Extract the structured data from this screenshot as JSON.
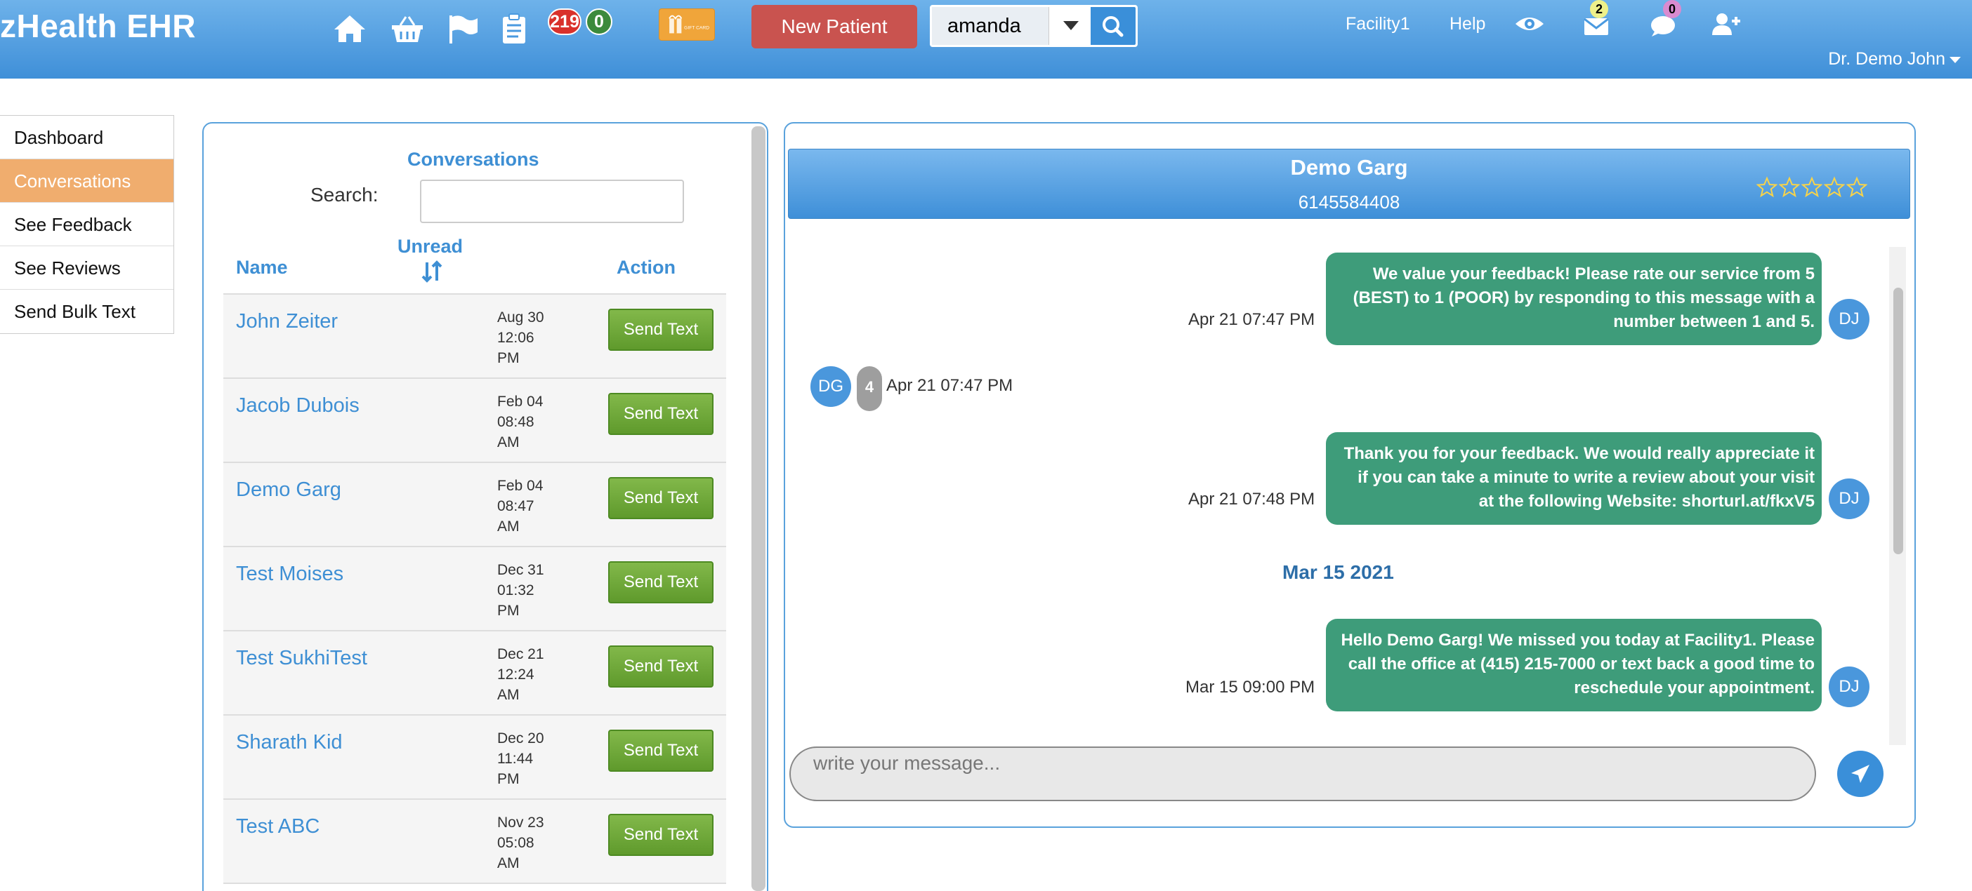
{
  "app": {
    "title": "zHealth EHR"
  },
  "topbar": {
    "icons": [
      "home-icon",
      "basket-icon",
      "flag-icon",
      "clipboard-icon"
    ],
    "badge_alerts": "219",
    "badge_zero": "0",
    "gift_card_label": "GIFT CARD",
    "new_patient_label": "New Patient",
    "search_value": "amanda",
    "facility": "Facility1",
    "help": "Help",
    "mail_count": "2",
    "chat_count": "0",
    "user": "Dr. Demo John",
    "colors": {
      "bar": "#4a9ae0",
      "new_patient": "#c9534f",
      "badge_red": "#d9312b",
      "badge_green": "#3c8a3c"
    }
  },
  "sidebar": {
    "items": [
      {
        "label": "Dashboard",
        "active": false
      },
      {
        "label": "Conversations",
        "active": true
      },
      {
        "label": "See Feedback",
        "active": false
      },
      {
        "label": "See Reviews",
        "active": false
      },
      {
        "label": "Send Bulk Text",
        "active": false
      }
    ]
  },
  "conversations": {
    "title": "Conversations",
    "search_label": "Search:",
    "search_value": "",
    "headers": {
      "name": "Name",
      "unread": "Unread",
      "action": "Action"
    },
    "send_label": "Send Text",
    "rows": [
      {
        "name": "John Zeiter",
        "date": "Aug 30",
        "time": "12:06",
        "ampm": "PM"
      },
      {
        "name": "Jacob Dubois",
        "date": "Feb 04",
        "time": "08:48",
        "ampm": "AM"
      },
      {
        "name": "Demo Garg",
        "date": "Feb 04",
        "time": "08:47",
        "ampm": "AM"
      },
      {
        "name": "Test Moises",
        "date": "Dec 31",
        "time": "01:32",
        "ampm": "PM"
      },
      {
        "name": "Test SukhiTest",
        "date": "Dec 21",
        "time": "12:24",
        "ampm": "AM"
      },
      {
        "name": "Sharath Kid",
        "date": "Dec 20",
        "time": "11:44",
        "ampm": "PM"
      },
      {
        "name": "Test ABC",
        "date": "Nov 23",
        "time": "05:08",
        "ampm": "AM"
      }
    ]
  },
  "chat": {
    "contact_name": "Demo Garg",
    "contact_phone": "6145584408",
    "rating_stars": 0,
    "messages": [
      {
        "time": "Apr 21 07:47 PM",
        "text": "We value your feedback! Please rate our service from 5 (BEST) to 1 (POOR) by responding to this message with a number between 1 and 5.",
        "sender": "DJ"
      },
      {
        "time": "Apr 21 07:47 PM",
        "text": "4",
        "sender": "DG"
      },
      {
        "time": "Apr 21 07:48 PM",
        "text": "Thank you for your feedback. We would really appreciate it if you can take a minute to write a review about your visit at the following Website: shorturl.at/fkxV5",
        "sender": "DJ"
      },
      {
        "time": "Mar 15 09:00 PM",
        "text": "Hello Demo Garg! We missed you today at Facility1. Please call the office at (415) 215-7000 or text back a good time to reschedule your appointment.",
        "sender": "DJ"
      }
    ],
    "date_separator": "Mar 15 2021",
    "compose_placeholder": "write your message..."
  }
}
